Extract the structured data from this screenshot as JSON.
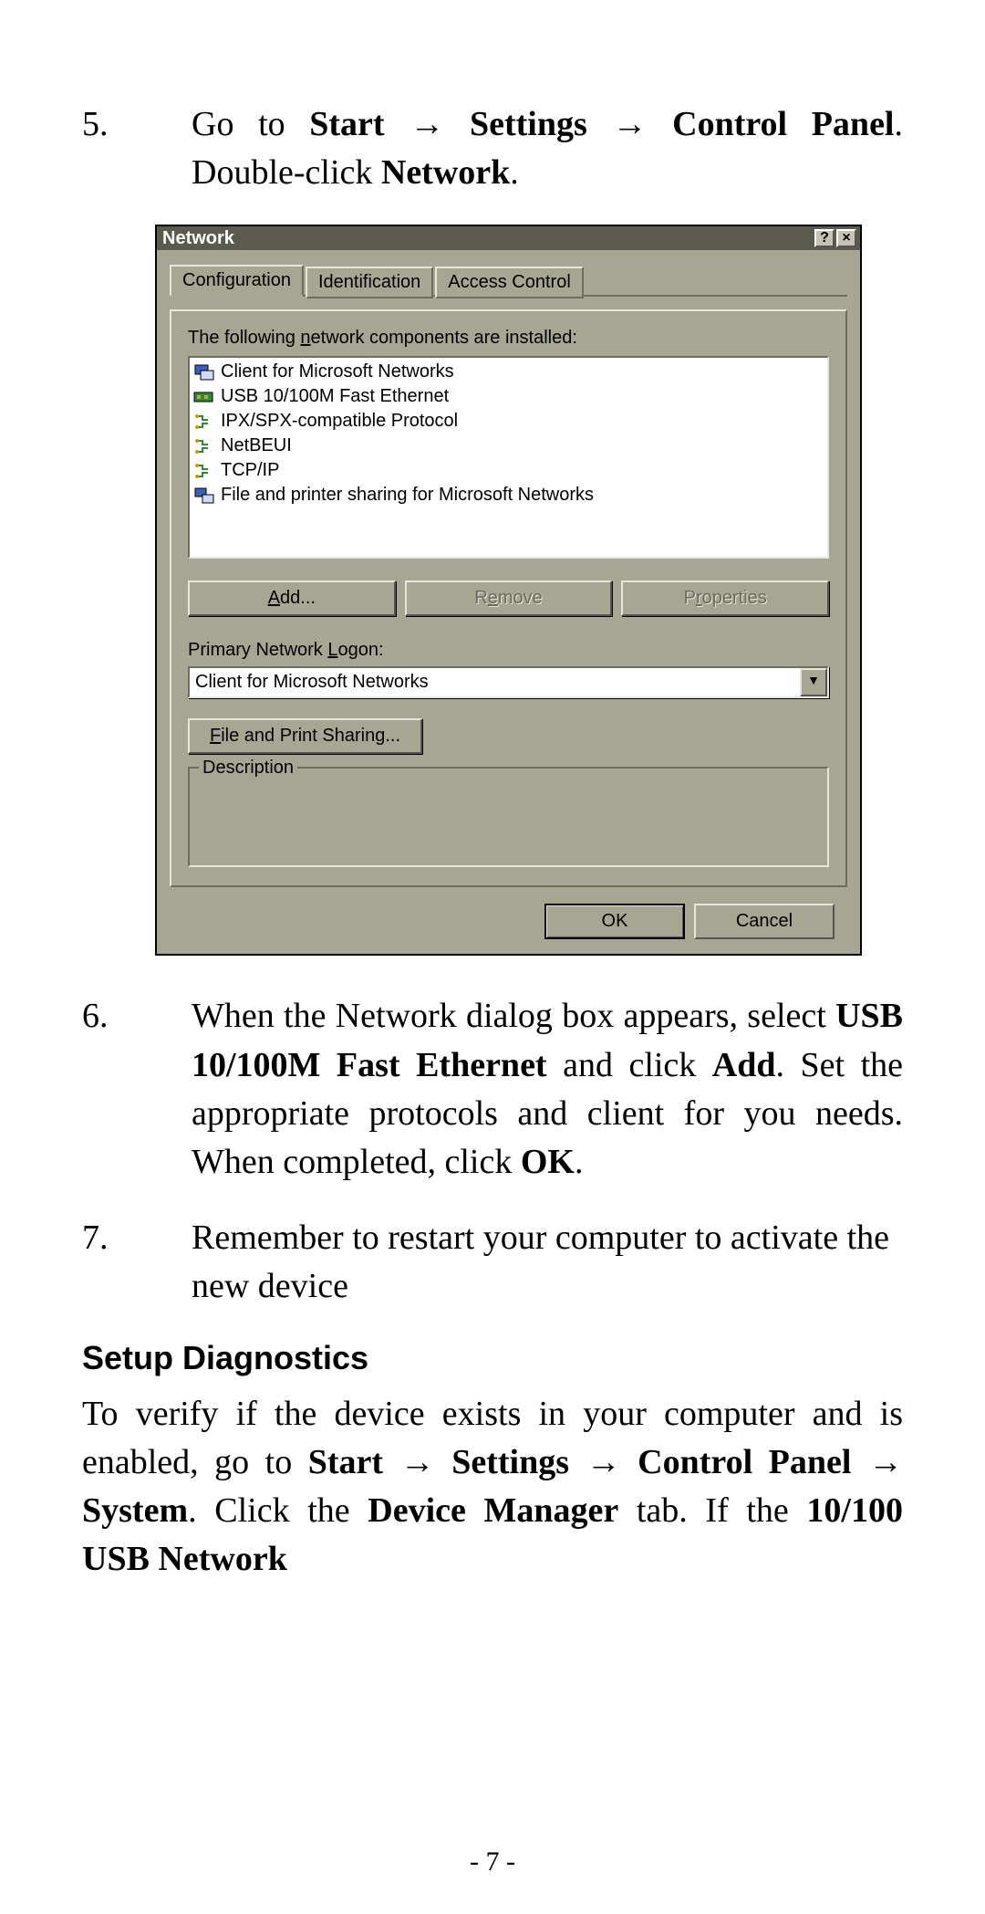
{
  "steps": {
    "s5": {
      "num": "5.",
      "t1": "Go to ",
      "b1": "Start",
      "arr": " → ",
      "b2": "Settings",
      "b3": "Control Panel",
      "t2": ". Double-click ",
      "b4": "Network",
      "t3": "."
    },
    "s6": {
      "num": "6.",
      "t1": "When the Network dialog box appears, select ",
      "b1": "USB 10/100M Fast Ethernet",
      "t2": " and click ",
      "b2": "Add",
      "t3": ". Set the appropriate protocols and client for you needs. When completed, click ",
      "b3": "OK",
      "t4": "."
    },
    "s7": {
      "num": "7.",
      "t1": "Remember to restart your computer to activate the new device"
    }
  },
  "heading": "Setup Diagnostics",
  "diag": {
    "t1": "To verify if the device exists in your computer and is enabled, go to ",
    "b1": "Start",
    "arr": " → ",
    "b2": "Settings",
    "b3": "Control Panel",
    "b4": "System",
    "t2": ". Click the ",
    "b5": "Device Manager",
    "t3": " tab. If the ",
    "b6": "10/100 USB Network"
  },
  "dlg": {
    "title": "Network",
    "help": "?",
    "close": "×",
    "tabs": [
      "Configuration",
      "Identification",
      "Access Control"
    ],
    "list_label": "The following network components are installed:",
    "items": [
      "Client for Microsoft Networks",
      "USB 10/100M Fast Ethernet",
      "IPX/SPX-compatible Protocol",
      "NetBEUI",
      "TCP/IP",
      "File and printer sharing for Microsoft Networks"
    ],
    "btn_add": "Add...",
    "btn_remove": "Remove",
    "btn_props": "Properties",
    "logon_label": "Primary Network Logon:",
    "logon_value": "Client for Microsoft Networks",
    "fps": "File and Print Sharing...",
    "desc": "Description",
    "ok": "OK",
    "cancel": "Cancel"
  },
  "page_num": "- 7 -"
}
